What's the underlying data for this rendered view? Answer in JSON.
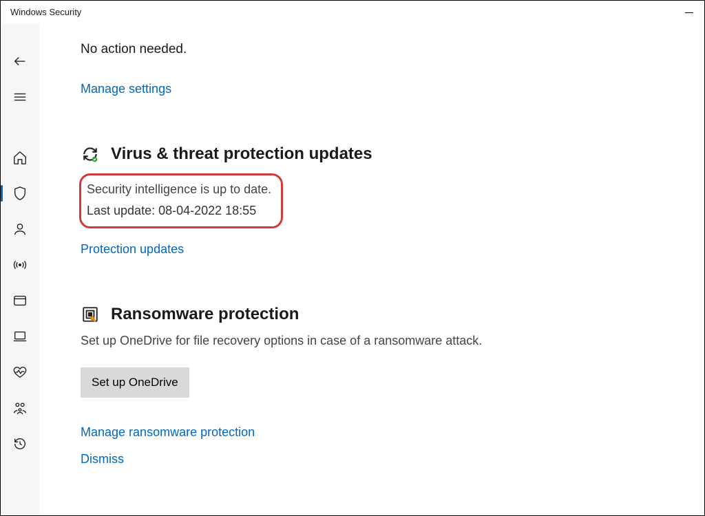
{
  "window": {
    "title": "Windows Security"
  },
  "statusBlock": {
    "message": "No action needed.",
    "manageLink": "Manage settings"
  },
  "updates": {
    "heading": "Virus & threat protection updates",
    "line1": "Security intelligence is up to date.",
    "line2": "Last update: 08-04-2022 18:55",
    "protectionLink": "Protection updates"
  },
  "ransomware": {
    "heading": "Ransomware protection",
    "description": "Set up OneDrive for file recovery options in case of a ransomware attack.",
    "button": "Set up OneDrive",
    "manageLink": "Manage ransomware protection",
    "dismissLink": "Dismiss"
  }
}
